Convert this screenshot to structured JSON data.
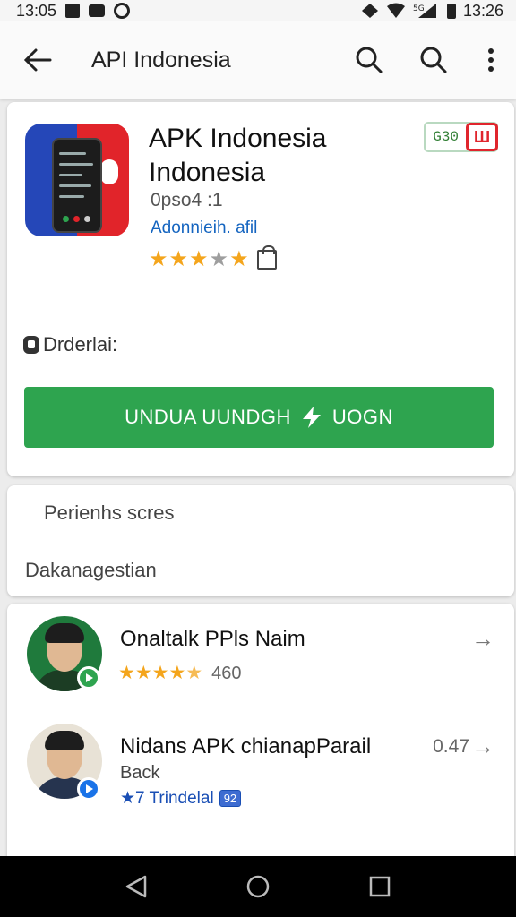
{
  "status_bar": {
    "time_left": "13:05",
    "time_right": "13:26"
  },
  "app_bar": {
    "title": "API Indonesia"
  },
  "app": {
    "title": "APK Indonesia Indonesia",
    "meta": "0pso4 :1",
    "developer": "Adonnieih. afil",
    "rating_stars": 4,
    "badge_text": "G30",
    "download_label": "Drderlai:",
    "install_button": "UNDUA  UUNDGH",
    "install_button_suffix": "UOGN"
  },
  "info": {
    "row1": "Perienhs scres",
    "row2": "Dakanagestian"
  },
  "list": [
    {
      "title": "Onaltalk PPls Naim",
      "rating_stars": 4.5,
      "rating_text": "460",
      "accent": "#2ea44f"
    },
    {
      "title": "Nidans APK chianapParail",
      "number": "0.47",
      "subtitle": "Back",
      "blue_text": "★7 Trindelal",
      "chip": "92",
      "accent": "#1a73e8"
    }
  ],
  "colors": {
    "install_green": "#2ea44f",
    "star": "#f4a51c",
    "link_blue": "#1565c0",
    "badge_red": "#e0252d"
  }
}
